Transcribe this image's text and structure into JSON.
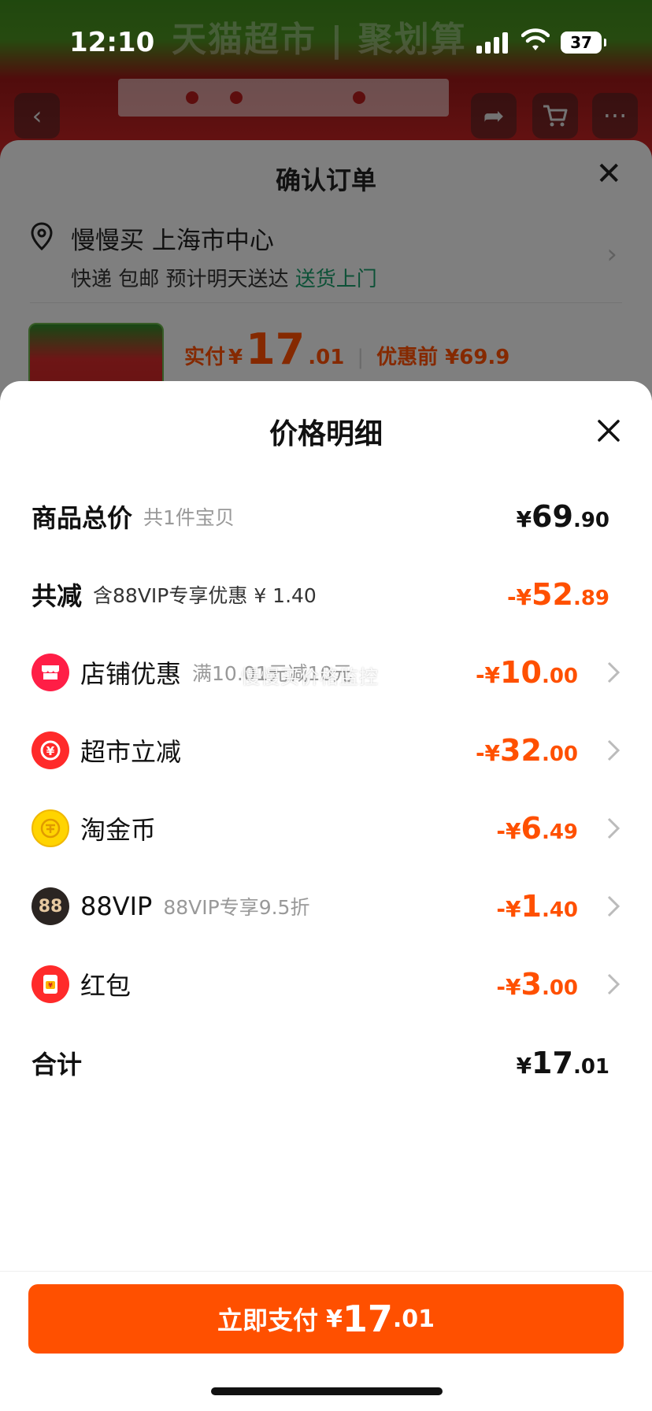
{
  "status_bar": {
    "time": "12:10",
    "battery": "37"
  },
  "background": {
    "banner_title": "天猫超市 | 聚划算",
    "confirm_title": "确认订单",
    "address_name": "慢慢买 上海市中心",
    "delivery_text": "快递 包邮 预计明天送达",
    "delivery_link": "送货上门",
    "price_label": "实付",
    "price_currency": "¥",
    "price_int": "17",
    "price_dec": ".01",
    "price_before": "优惠前 ¥69.9"
  },
  "detail": {
    "title": "价格明细",
    "rows": [
      {
        "label": "商品总价",
        "sub": "共1件宝贝",
        "currency": "¥",
        "int": "69",
        "dec": ".90"
      },
      {
        "label": "共减",
        "sub": "含88VIP专享优惠 ¥ 1.40",
        "currency": "-¥",
        "int": "52",
        "dec": ".89"
      },
      {
        "label": "店铺优惠",
        "sub": "满10.01元减10元",
        "currency": "-¥",
        "int": "10",
        "dec": ".00",
        "icon": "store-icon"
      },
      {
        "label": "超市立减",
        "sub": "",
        "currency": "-¥",
        "int": "32",
        "dec": ".00",
        "icon": "supermarket-discount-icon"
      },
      {
        "label": "淘金币",
        "sub": "",
        "currency": "-¥",
        "int": "6",
        "dec": ".49",
        "icon": "gold-coin-icon"
      },
      {
        "label": "88VIP",
        "sub": "88VIP专享9.5折",
        "currency": "-¥",
        "int": "1",
        "dec": ".40",
        "icon": "88vip-icon",
        "icon_text": "88"
      },
      {
        "label": "红包",
        "sub": "",
        "currency": "-¥",
        "int": "3",
        "dec": ".00",
        "icon": "red-envelope-icon"
      },
      {
        "label": "合计",
        "sub": "",
        "currency": "¥",
        "int": "17",
        "dec": ".01"
      }
    ]
  },
  "watermark": "慢慢买价格监控",
  "pay_button": {
    "label": "立即支付",
    "currency": "¥",
    "int": "17",
    "dec": ".01"
  },
  "colors": {
    "accent": "#ff5000",
    "green_link": "#1a9b6a"
  }
}
